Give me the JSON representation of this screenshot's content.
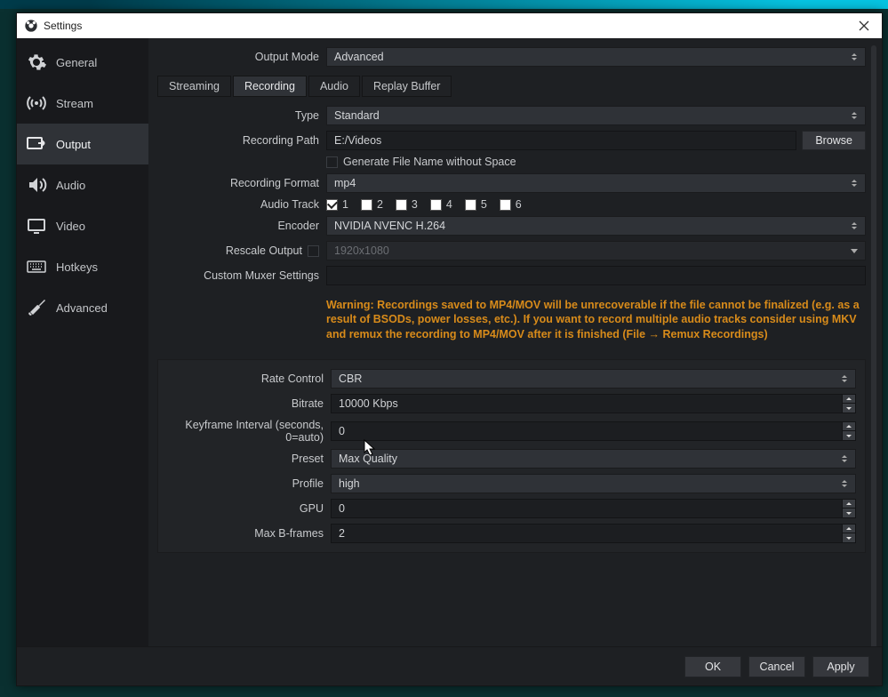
{
  "window": {
    "title": "Settings"
  },
  "sidebar": {
    "items": [
      {
        "label": "General"
      },
      {
        "label": "Stream"
      },
      {
        "label": "Output"
      },
      {
        "label": "Audio"
      },
      {
        "label": "Video"
      },
      {
        "label": "Hotkeys"
      },
      {
        "label": "Advanced"
      }
    ],
    "selected_index": 2
  },
  "output_mode": {
    "label": "Output Mode",
    "value": "Advanced"
  },
  "tabs": {
    "items": [
      {
        "label": "Streaming"
      },
      {
        "label": "Recording"
      },
      {
        "label": "Audio"
      },
      {
        "label": "Replay Buffer"
      }
    ],
    "active_index": 1
  },
  "recording": {
    "type": {
      "label": "Type",
      "value": "Standard"
    },
    "path": {
      "label": "Recording Path",
      "value": "E:/Videos",
      "browse": "Browse"
    },
    "gen_no_space": {
      "label": "Generate File Name without Space",
      "checked": false
    },
    "format": {
      "label": "Recording Format",
      "value": "mp4"
    },
    "audio_track": {
      "label": "Audio Track",
      "tracks": [
        {
          "num": "1",
          "checked": true
        },
        {
          "num": "2",
          "checked": false
        },
        {
          "num": "3",
          "checked": false
        },
        {
          "num": "4",
          "checked": false
        },
        {
          "num": "5",
          "checked": false
        },
        {
          "num": "6",
          "checked": false
        }
      ]
    },
    "encoder": {
      "label": "Encoder",
      "value": "NVIDIA NVENC H.264"
    },
    "rescale": {
      "label": "Rescale Output",
      "checked": false,
      "value": "1920x1080"
    },
    "muxer": {
      "label": "Custom Muxer Settings",
      "value": ""
    },
    "warning": "Warning: Recordings saved to MP4/MOV will be unrecoverable if the file cannot be finalized (e.g. as a result of BSODs, power losses, etc.). If you want to record multiple audio tracks consider using MKV and remux the recording to MP4/MOV after it is finished (File → Remux Recordings)"
  },
  "encoder_settings": {
    "rate_control": {
      "label": "Rate Control",
      "value": "CBR"
    },
    "bitrate": {
      "label": "Bitrate",
      "value": "10000 Kbps"
    },
    "keyframe": {
      "label": "Keyframe Interval (seconds, 0=auto)",
      "value": "0"
    },
    "preset": {
      "label": "Preset",
      "value": "Max Quality"
    },
    "profile": {
      "label": "Profile",
      "value": "high"
    },
    "gpu": {
      "label": "GPU",
      "value": "0"
    },
    "max_bframes": {
      "label": "Max B-frames",
      "value": "2"
    }
  },
  "footer": {
    "ok": "OK",
    "cancel": "Cancel",
    "apply": "Apply"
  }
}
